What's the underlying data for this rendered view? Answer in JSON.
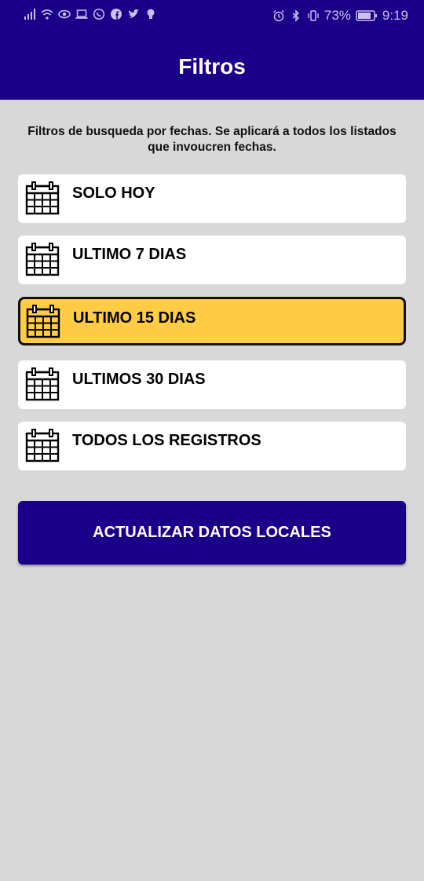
{
  "status_bar": {
    "battery": "73%",
    "time": "9:19"
  },
  "header": {
    "title": "Filtros"
  },
  "description": "Filtros de busqueda por fechas. Se aplicará a todos los listados que invoucren fechas.",
  "filters": [
    {
      "label": "SOLO HOY",
      "selected": false
    },
    {
      "label": "ULTIMO 7 DIAS",
      "selected": false
    },
    {
      "label": "ULTIMO 15 DIAS",
      "selected": true
    },
    {
      "label": "ULTIMOS 30 DIAS",
      "selected": false
    },
    {
      "label": "TODOS LOS REGISTROS",
      "selected": false
    }
  ],
  "action_button": {
    "label": "ACTUALIZAR DATOS LOCALES"
  },
  "colors": {
    "primary": "#1a0088",
    "selected": "#ffcc44",
    "background": "#d8d8d8"
  }
}
